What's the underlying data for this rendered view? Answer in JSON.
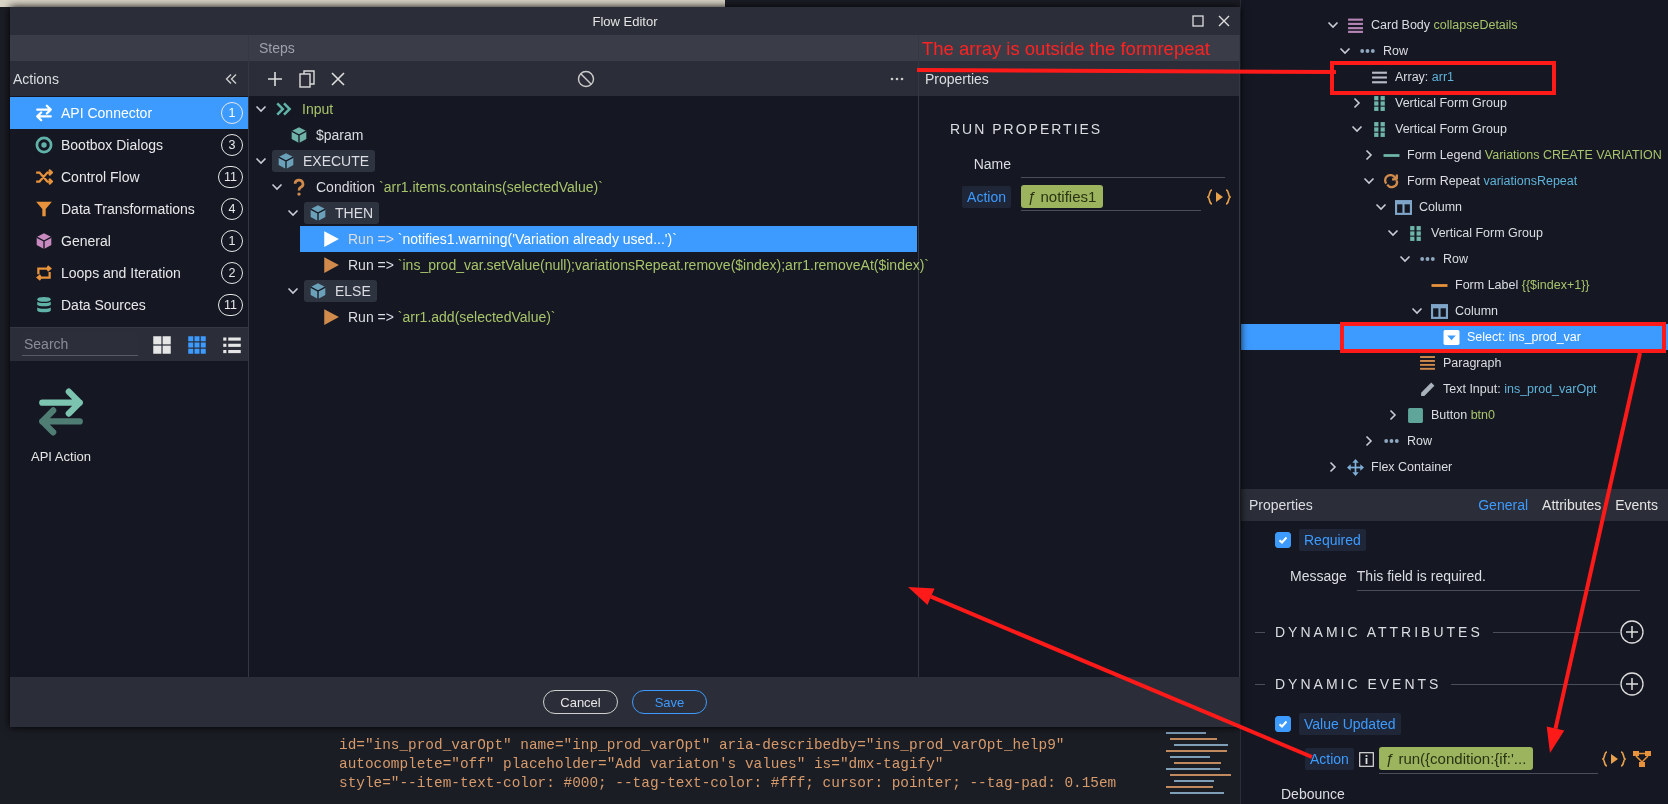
{
  "background_editor": {
    "code_lines": [
      "id=\"ins_prod_varOpt\" name=\"inp_prod_varOpt\" aria-describedby=\"ins_prod_varOpt_help9\"",
      "autocomplete=\"off\" placeholder=\"Add variaton's values\" is=\"dmx-tagify\"",
      "style=\"--item-text-color: #000; --tag-text-color: #fff; cursor: pointer; --tag-pad: 0.15em"
    ]
  },
  "flow_editor": {
    "title": "Flow Editor",
    "actions_panel": {
      "title": "Actions",
      "items": [
        {
          "kind": "api",
          "label": "API Connector",
          "count": "1",
          "selected": true
        },
        {
          "kind": "dialogs",
          "label": "Bootbox Dialogs",
          "count": "3",
          "selected": false
        },
        {
          "kind": "flow",
          "label": "Control Flow",
          "count": "11",
          "selected": false
        },
        {
          "kind": "transform",
          "label": "Data Transformations",
          "count": "4",
          "selected": false
        },
        {
          "kind": "general",
          "label": "General",
          "count": "1",
          "selected": false
        },
        {
          "kind": "loops",
          "label": "Loops and Iteration",
          "count": "2",
          "selected": false
        },
        {
          "kind": "datasources",
          "label": "Data Sources",
          "count": "11",
          "selected": false
        }
      ],
      "search": {
        "placeholder": "Search"
      },
      "view_modes": [
        {
          "kind": "large-grid",
          "selected": false
        },
        {
          "kind": "small-grid",
          "selected": true
        },
        {
          "kind": "list",
          "selected": false
        }
      ],
      "tiles": [
        {
          "kind": "api",
          "label": "API Action"
        }
      ]
    },
    "steps_panel": {
      "title": "Steps",
      "steps": [
        {
          "kind": "input",
          "label": "Input",
          "expanded": true,
          "selected": false,
          "children": [
            {
              "kind": "param",
              "label": "$param",
              "selected": false
            }
          ]
        },
        {
          "kind": "block",
          "label": "EXECUTE",
          "expanded": true,
          "selected": false,
          "children": [
            {
              "kind": "condition",
              "label": "Condition",
              "expr": "`arr1.items.contains(selectedValue)`",
              "expanded": true,
              "selected": false,
              "children": [
                {
                  "kind": "block",
                  "label": "THEN",
                  "expanded": true,
                  "selected": false,
                  "children": [
                    {
                      "kind": "run",
                      "label": "Run =>",
                      "expr": "`notifies1.warning('Variation already used...')`",
                      "selected": true
                    },
                    {
                      "kind": "run",
                      "label": "Run =>",
                      "expr": "`ins_prod_var.setValue(null);variationsRepeat.remove($index);arr1.removeAt($index)`",
                      "selected": false
                    }
                  ]
                },
                {
                  "kind": "block",
                  "label": "ELSE",
                  "expanded": true,
                  "selected": false,
                  "children": [
                    {
                      "kind": "run",
                      "label": "Run =>",
                      "expr": "`arr1.add(selectedValue)`",
                      "selected": false
                    }
                  ]
                }
              ]
            }
          ]
        }
      ]
    },
    "properties_panel": {
      "title": "Properties",
      "section": "RUN PROPERTIES",
      "fields": [
        {
          "kind": "text",
          "label": "Name"
        },
        {
          "kind": "action",
          "label": "Action",
          "value": "ƒ notifies1"
        }
      ]
    },
    "buttons": [
      {
        "kind": "secondary",
        "label": "Cancel"
      },
      {
        "kind": "primary",
        "label": "Save"
      }
    ]
  },
  "annotation": {
    "text": "The array is outside the formrepeat"
  },
  "component_tree": [
    {
      "kind": "card-body",
      "label": "Card Body",
      "detail": "collapseDetails",
      "color": "#a8c46a",
      "expanded": true,
      "selected": false,
      "children": [
        {
          "kind": "row",
          "label": "Row",
          "expanded": true,
          "selected": false,
          "children": [
            {
              "kind": "array",
              "label": "Array:",
              "detail": "arr1",
              "color": "#5fb2d8",
              "selected": false
            },
            {
              "kind": "form-group",
              "label": "Vertical Form Group",
              "expanded": false,
              "selected": false
            },
            {
              "kind": "form-group",
              "label": "Vertical Form Group",
              "expanded": true,
              "selected": false,
              "children": [
                {
                  "kind": "form-legend",
                  "label": "Form Legend",
                  "detail": "Variations CREATE VARIATION",
                  "color": "#a8c46a",
                  "expanded": false,
                  "selected": false
                },
                {
                  "kind": "form-repeat",
                  "label": "Form Repeat",
                  "detail": "variationsRepeat",
                  "color": "#5fb2d8",
                  "expanded": true,
                  "selected": false,
                  "children": [
                    {
                      "kind": "column",
                      "label": "Column",
                      "expanded": true,
                      "selected": false,
                      "children": [
                        {
                          "kind": "form-group",
                          "label": "Vertical Form Group",
                          "expanded": true,
                          "selected": false,
                          "children": [
                            {
                              "kind": "row",
                              "label": "Row",
                              "expanded": true,
                              "selected": false,
                              "children": [
                                {
                                  "kind": "form-label",
                                  "label": "Form Label",
                                  "detail": "{{$index+1}}",
                                  "color": "#a8c46a",
                                  "selected": false
                                },
                                {
                                  "kind": "column",
                                  "label": "Column",
                                  "expanded": true,
                                  "selected": false,
                                  "children": [
                                    {
                                      "kind": "select",
                                      "label": "Select: ins_prod_var",
                                      "selected": true
                                    }
                                  ]
                                }
                              ]
                            },
                            {
                              "kind": "paragraph",
                              "label": "Paragraph",
                              "selected": false
                            },
                            {
                              "kind": "text-input",
                              "label": "Text Input:",
                              "detail": "ins_prod_varOpt",
                              "color": "#5fb2d8",
                              "selected": false
                            }
                          ]
                        },
                        {
                          "kind": "button",
                          "label": "Button",
                          "detail": "btn0",
                          "color": "#a8c46a",
                          "expanded": false,
                          "selected": false
                        }
                      ]
                    }
                  ]
                },
                {
                  "kind": "row",
                  "label": "Row",
                  "expanded": false,
                  "selected": false
                }
              ]
            }
          ]
        }
      ]
    },
    {
      "kind": "flex",
      "label": "Flex Container",
      "expanded": false,
      "selected": false
    }
  ],
  "properties": {
    "title": "Properties",
    "tabs": [
      {
        "label": "General",
        "selected": true
      },
      {
        "label": "Attributes",
        "selected": false
      },
      {
        "label": "Events",
        "selected": false
      }
    ],
    "required": {
      "label": "Required",
      "checked": true
    },
    "message": {
      "label": "Message",
      "value": "This field is required."
    },
    "sections": [
      {
        "title": "DYNAMIC ATTRIBUTES"
      },
      {
        "title": "DYNAMIC EVENTS"
      }
    ],
    "events": [
      {
        "label": "Value Updated",
        "checked": true,
        "action_label": "Action",
        "action_value": "ƒ run({condition:{if:'..."
      }
    ],
    "debounce_label": "Debounce"
  }
}
